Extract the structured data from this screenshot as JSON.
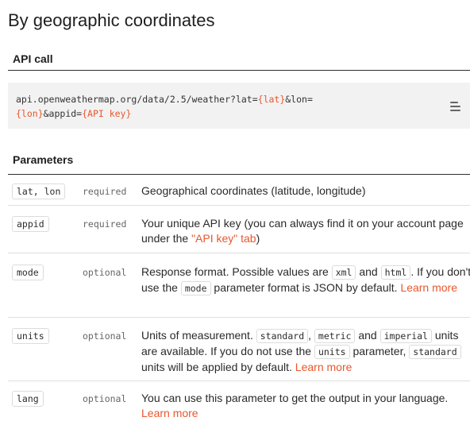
{
  "page": {
    "title": "By geographic coordinates"
  },
  "api_call": {
    "heading": "API call",
    "line1_text": "api.openweathermap.org/data/2.5/weather?lat=",
    "var_lat": "{lat}",
    "line1_lon": "&lon=",
    "var_lon": "{lon}",
    "line2_appid": "&appid=",
    "var_key": "{API key}",
    "menu_icon": "hamburger-menu-icon"
  },
  "parameters": {
    "heading": "Parameters",
    "rows": [
      {
        "name": "lat, lon",
        "requirement": "required",
        "description": "Geographical coordinates (latitude, longitude)"
      },
      {
        "name": "appid",
        "requirement": "required",
        "desc_text": "Your unique API key (you can always find it on your account page under the ",
        "desc_link": "\"API key\" tab",
        "desc_end": ")"
      },
      {
        "name": "mode",
        "requirement": "optional",
        "desc_a": "Response format. Possible values are ",
        "code_1": "xml",
        "desc_b": " and ",
        "code_2": "html",
        "desc_c": ". If you don't use the ",
        "code_3": "mode",
        "desc_d": " parameter format is JSON by default. ",
        "link": "Learn more"
      },
      {
        "name": "units",
        "requirement": "optional",
        "desc_a": "Units of measurement. ",
        "code_1": "standard",
        "desc_b": ", ",
        "code_2": "metric",
        "desc_c": " and ",
        "code_3": "imperial",
        "desc_d": " units are available. If you do not use the ",
        "code_4": "units",
        "desc_e": " parameter, ",
        "code_5": "standard",
        "desc_f": " units will be applied by default. ",
        "link": "Learn more"
      },
      {
        "name": "lang",
        "requirement": "optional",
        "desc_a": "You can use this parameter to get the output in your language. ",
        "link": "Learn more"
      }
    ]
  },
  "colors": {
    "accent": "#e9572e",
    "code_background": "#f2f2f2",
    "rule": "#2e2e2e"
  }
}
